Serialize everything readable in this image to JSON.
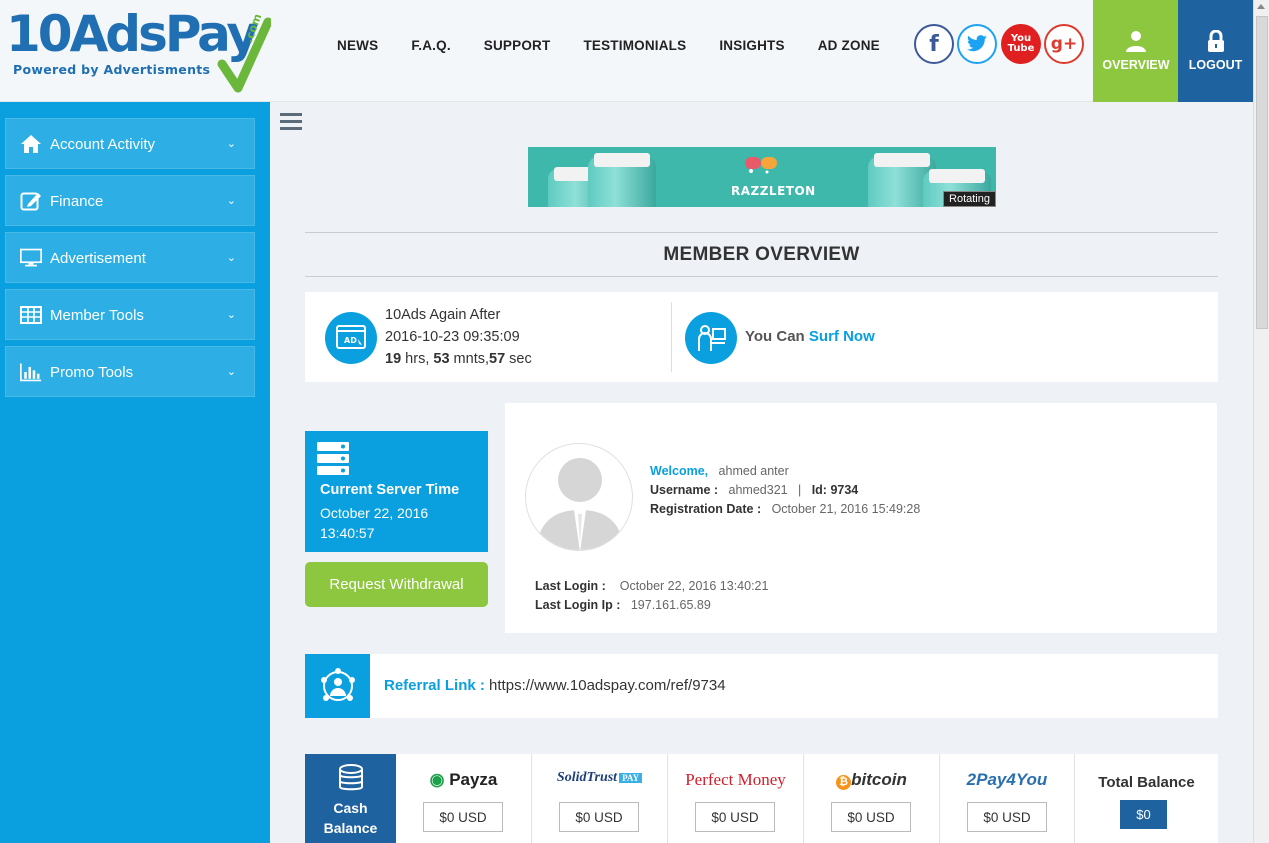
{
  "logo": {
    "main": "10AdsPay",
    "tagline": "Powered by Advertisments",
    "com": ".com"
  },
  "nav": [
    "NEWS",
    "F.A.Q.",
    "SUPPORT",
    "TESTIMONIALS",
    "INSIGHTS",
    "AD ZONE"
  ],
  "social": {
    "youtube_top": "You",
    "youtube_bottom": "Tube"
  },
  "header_buttons": {
    "overview": "OVERVIEW",
    "logout": "LOGOUT"
  },
  "sidebar": {
    "items": [
      {
        "label": "Account Activity",
        "icon": "home-icon"
      },
      {
        "label": "Finance",
        "icon": "edit-icon"
      },
      {
        "label": "Advertisement",
        "icon": "monitor-icon"
      },
      {
        "label": "Member Tools",
        "icon": "table-icon"
      },
      {
        "label": "Promo Tools",
        "icon": "bar-chart-icon"
      }
    ]
  },
  "banner": {
    "brand": "RAZZLETON",
    "badge": "Rotating"
  },
  "overview_title": "MEMBER OVERVIEW",
  "ads_again": {
    "title": "10Ads Again After",
    "datetime": "2016-10-23 09:35:09",
    "hrs": "19",
    "hrs_label": "hrs,",
    "mnts": "53",
    "mnts_label": "mnts,",
    "sec": "57",
    "sec_label": "sec"
  },
  "surf": {
    "text": "You Can",
    "link": "Surf Now"
  },
  "server_time": {
    "title": "Current Server Time",
    "date": "October 22, 2016",
    "time": "13:40:57"
  },
  "withdraw_button": "Request Withdrawal",
  "profile": {
    "welcome_label": "Welcome,",
    "name": "ahmed anter",
    "username_label": "Username :",
    "username": "ahmed321",
    "sep": "|",
    "id_label": "Id:",
    "id": "9734",
    "reg_label": "Registration Date :",
    "reg_date": "October 21, 2016 15:49:28",
    "last_login_label": "Last Login :",
    "last_login": "October 22, 2016 13:40:21",
    "last_ip_label": "Last Login Ip :",
    "last_ip": "197.161.65.89"
  },
  "referral": {
    "label": "Referral Link :",
    "url": "https://www.10adspay.com/ref/9734"
  },
  "balances": {
    "cash_label_1": "Cash",
    "cash_label_2": "Balance",
    "processors": [
      {
        "name": "Payza",
        "amount": "$0 USD"
      },
      {
        "name": "SolidTrust",
        "amount": "$0 USD"
      },
      {
        "name": "Perfect Money",
        "amount": "$0 USD"
      },
      {
        "name": "bitcoin",
        "amount": "$0 USD"
      },
      {
        "name": "2Pay4You",
        "amount": "$0 USD"
      }
    ],
    "pay_badge": "PAY",
    "total_label": "Total Balance",
    "total": "$0"
  },
  "colors": {
    "blue": "#0aa0df",
    "dark_blue": "#1e62a0",
    "green": "#8dc63f"
  }
}
